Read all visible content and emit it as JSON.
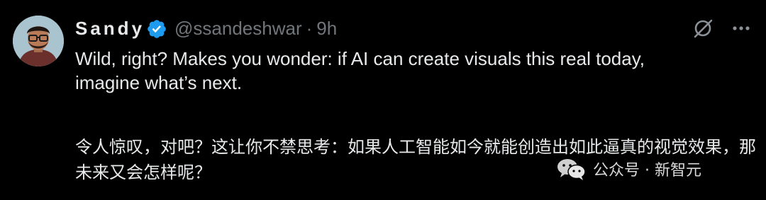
{
  "tweet": {
    "display_name": "Sandy",
    "handle": "@ssandeshwar",
    "separator": "·",
    "time": "9h",
    "text_en": "Wild, right? Makes you wonder: if AI can create visuals this real today, imagine what’s next.",
    "text_zh": "令人惊叹，对吧？这让你不禁思考：如果人工智能如今就能创造出如此逼真的视觉效果，那未来又会怎样呢？"
  },
  "icons": {
    "verified": "verified-badge-icon",
    "grok": "grok-icon",
    "more": "more-icon",
    "wechat": "wechat-icon"
  },
  "watermark": {
    "label": "公众号 · 新智元"
  },
  "colors": {
    "background": "#000000",
    "text": "#e7e9ea",
    "muted": "#71767b",
    "verified": "#1d9bf0"
  }
}
